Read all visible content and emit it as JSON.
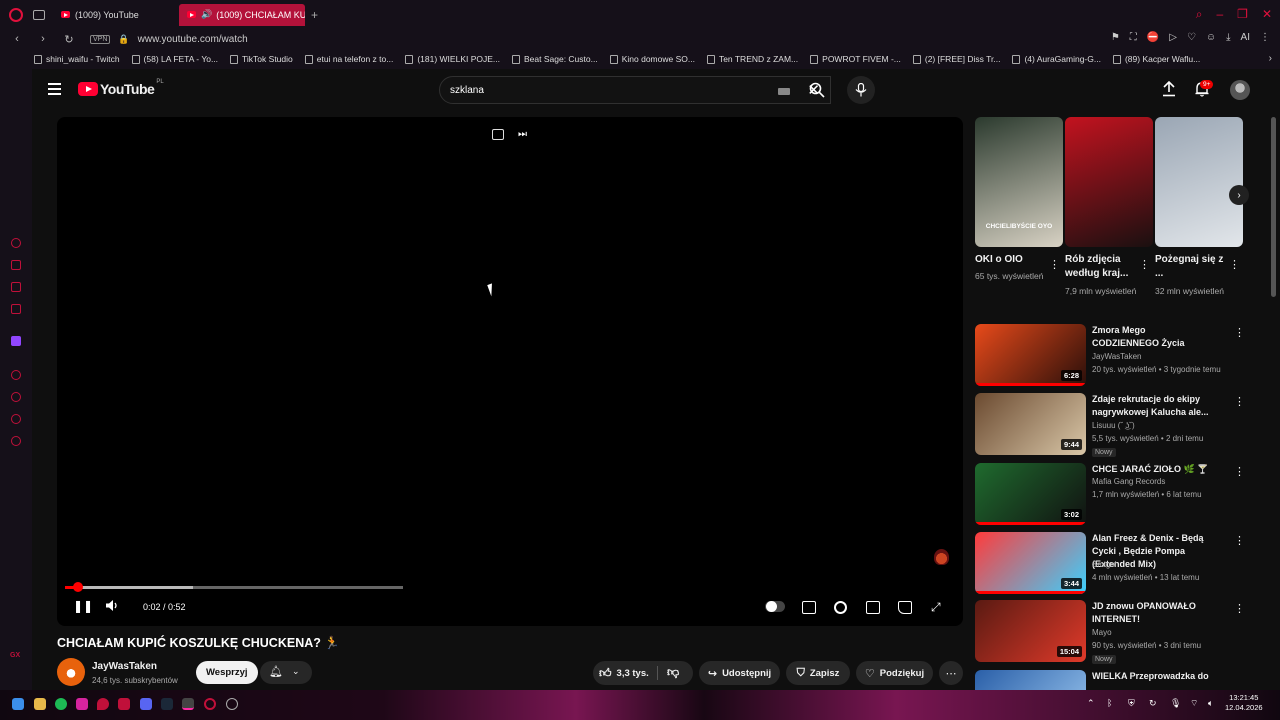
{
  "browser": {
    "tabs": [
      {
        "label": "(1009) YouTube"
      },
      {
        "label": "(1009) CHCIAŁAM KUI"
      }
    ],
    "url": "www.youtube.com/watch",
    "vpn_label": "VPN",
    "ai_label": "AI",
    "bookmarks": [
      "shini_waifu - Twitch",
      "(58) LA FETA - Yo...",
      "TikTok Studio",
      "etui na telefon z to...",
      "(181) WIELKI POJE...",
      "Beat Sage: Custo...",
      "Kino domowe SO...",
      "Ten TREND z ZAM...",
      "POWROT FIVEM -...",
      "(2) [FREE] Diss Tr...",
      "(4) AuraGaming-G...",
      "(89) Kacper Waflu..."
    ],
    "sidebar_gx": "GX"
  },
  "youtube": {
    "logo_text": "YouTube",
    "region": "PL",
    "search_query": "szklana",
    "notifications_badge": "9+"
  },
  "player": {
    "time_current": "0:02",
    "time_total": "0:52",
    "time_display": "0:02 / 0:52",
    "progress_fraction": 0.038,
    "buffered_fraction": 0.38
  },
  "video": {
    "title": "CHCIAŁAM KUPIĆ KOSZULKĘ CHUCKENA? 🏃",
    "channel": "JayWasTaken",
    "subscribers": "24,6 tys. subskrybentów",
    "support_label": "Wesprzyj",
    "likes": "3,3 tys.",
    "share_label": "Udostępnij",
    "save_label": "Zapisz",
    "thanks_label": "Podziękuj"
  },
  "shorts": [
    {
      "title": "OKI o OIO",
      "meta": "65 tys. wyświetleń",
      "caption": "CHCIELIBYŚCIE OYO",
      "colors": [
        "#2b3a2e",
        "#d8d2c4"
      ]
    },
    {
      "title": "Rób zdjęcia według kraj...",
      "meta": "7,9 mln wyświetleń",
      "caption": "",
      "colors": [
        "#c3121f",
        "#1a1010"
      ]
    },
    {
      "title": "Pożegnaj się z ...",
      "meta": "32 mln wyświetleń",
      "caption": "",
      "colors": [
        "#9aa6b4",
        "#e2e6ea"
      ]
    }
  ],
  "recommendations": [
    {
      "title": "Zmora Mego CODZIENNEGO Życia",
      "channel": "JayWasTaken",
      "meta": "20 tys. wyświetleń • 3 tygodnie temu",
      "duration": "6:28",
      "new": "",
      "watched": 1.0,
      "colors": [
        "#e84a1a",
        "#2a0f0a"
      ]
    },
    {
      "title": "Zdaje rekrutacje do ekipy nagrywkowej Kalucha ale...",
      "channel": "Lisuuu (˘ ͜ʖ˘)",
      "meta": "5,5 tys. wyświetleń • 2 dni temu",
      "duration": "9:44",
      "new": "Nowy",
      "watched": 0,
      "colors": [
        "#6b4a30",
        "#d9c7a8"
      ]
    },
    {
      "title": "CHCE JARAĆ ZIOŁO 🌿 🍸",
      "channel": "Mafia Gang Records",
      "meta": "1,7 mln wyświetleń • 6 lat temu",
      "duration": "3:02",
      "new": "",
      "watched": 1.0,
      "colors": [
        "#1f6b2e",
        "#111"
      ]
    },
    {
      "title": "Alan Freez & Denix - Będą Cycki , Będzie Pompa (Extended Mix)",
      "channel": "Smigol",
      "meta": "4 mln wyświetleń • 13 lat temu",
      "duration": "3:44",
      "new": "",
      "watched": 1.0,
      "colors": [
        "#ff3b3b",
        "#3bd1ff"
      ]
    },
    {
      "title": "JD znowu OPANOWAŁO INTERNET!",
      "channel": "Mayo",
      "meta": "90 tys. wyświetleń • 3 dni temu",
      "duration": "15:04",
      "new": "Nowy",
      "watched": 0,
      "colors": [
        "#5a1a12",
        "#e03a2a"
      ]
    },
    {
      "title": "WIELKA Przeprowadzka do",
      "channel": "",
      "meta": "",
      "duration": "",
      "new": "",
      "watched": 0,
      "colors": [
        "#2a5fa8",
        "#9cc8f0"
      ]
    }
  ],
  "taskbar": {
    "time": "13:21:45",
    "date": "12.04.2026"
  }
}
